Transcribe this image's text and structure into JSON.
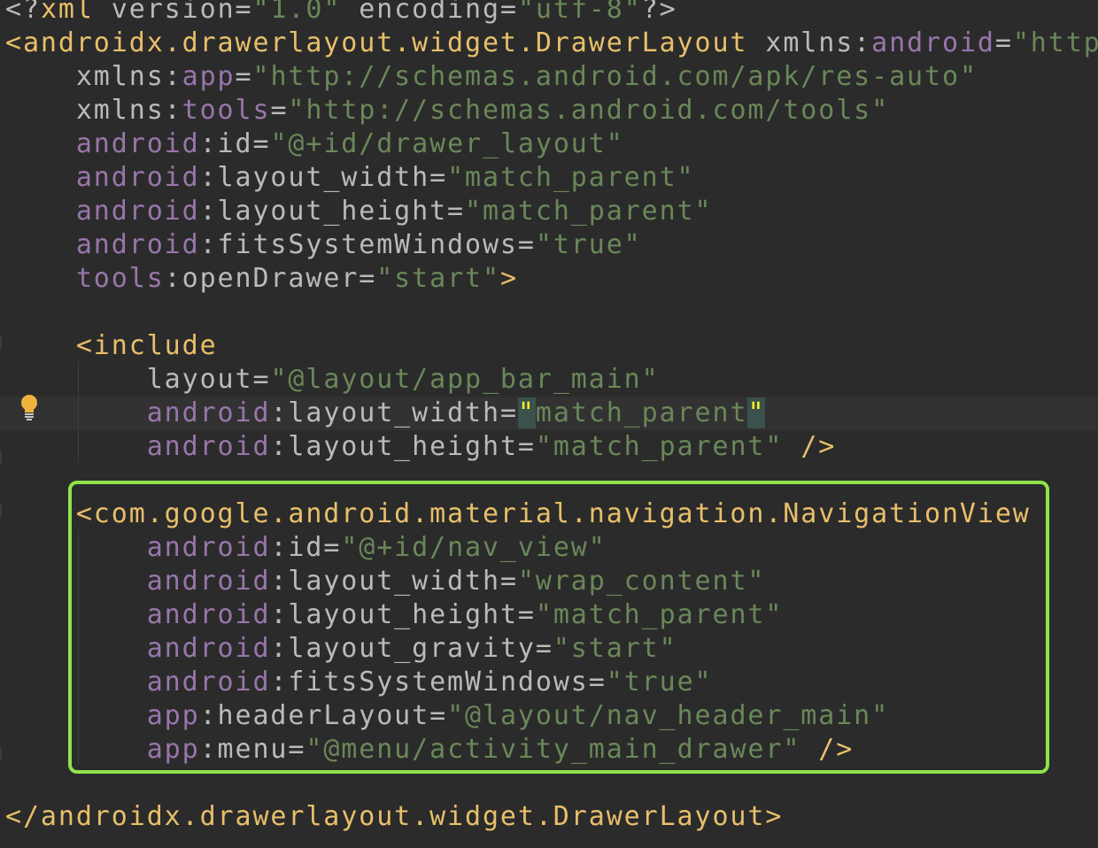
{
  "editor": {
    "language": "xml",
    "colors": {
      "background": "#2b2b2b",
      "tag": "#e8bf6a",
      "namespace": "#9876aa",
      "attribute": "#bababa",
      "string": "#6a8759",
      "highlight_border": "#8fe24a"
    },
    "lines": [
      [
        [
          "punct",
          "<?"
        ],
        [
          "tag",
          "xml "
        ],
        [
          "attr",
          "version"
        ],
        [
          "punct",
          "="
        ],
        [
          "val",
          "\"1.0\" "
        ],
        [
          "attr",
          "encoding"
        ],
        [
          "punct",
          "="
        ],
        [
          "val",
          "\"utf-8\""
        ],
        [
          "punct",
          "?>"
        ]
      ],
      [
        [
          "tag",
          "<androidx.drawerlayout.widget.DrawerLayout "
        ],
        [
          "attr",
          "xmlns:"
        ],
        [
          "ns",
          "android"
        ],
        [
          "punct",
          "="
        ],
        [
          "val",
          "\"http"
        ]
      ],
      [
        [
          "attr",
          "    xmlns:"
        ],
        [
          "ns",
          "app"
        ],
        [
          "punct",
          "="
        ],
        [
          "val",
          "\"http://schemas.android.com/apk/res-auto\""
        ]
      ],
      [
        [
          "attr",
          "    xmlns:"
        ],
        [
          "ns",
          "tools"
        ],
        [
          "punct",
          "="
        ],
        [
          "val",
          "\"http://schemas.android.com/tools\""
        ]
      ],
      [
        [
          "ns",
          "    android"
        ],
        [
          "punct",
          ":"
        ],
        [
          "attr",
          "id"
        ],
        [
          "punct",
          "="
        ],
        [
          "val",
          "\"@+id/drawer_layout\""
        ]
      ],
      [
        [
          "ns",
          "    android"
        ],
        [
          "punct",
          ":"
        ],
        [
          "attr",
          "layout_width"
        ],
        [
          "punct",
          "="
        ],
        [
          "val",
          "\"match_parent\""
        ]
      ],
      [
        [
          "ns",
          "    android"
        ],
        [
          "punct",
          ":"
        ],
        [
          "attr",
          "layout_height"
        ],
        [
          "punct",
          "="
        ],
        [
          "val",
          "\"match_parent\""
        ]
      ],
      [
        [
          "ns",
          "    android"
        ],
        [
          "punct",
          ":"
        ],
        [
          "attr",
          "fitsSystemWindows"
        ],
        [
          "punct",
          "="
        ],
        [
          "val",
          "\"true\""
        ]
      ],
      [
        [
          "ns",
          "    tools"
        ],
        [
          "punct",
          ":"
        ],
        [
          "attr",
          "openDrawer"
        ],
        [
          "punct",
          "="
        ],
        [
          "val",
          "\"start\""
        ],
        [
          "tag",
          ">"
        ]
      ],
      [],
      [
        [
          "tag",
          "    <include"
        ]
      ],
      [
        [
          "attr",
          "        layout"
        ],
        [
          "punct",
          "="
        ],
        [
          "val",
          "\"@layout/app_bar_main\""
        ]
      ],
      [
        [
          "ns",
          "        android"
        ],
        [
          "punct",
          ":"
        ],
        [
          "attr",
          "layout_width"
        ],
        [
          "punct",
          "="
        ],
        [
          "quote-hl",
          "\""
        ],
        [
          "val",
          "match_parent"
        ],
        [
          "quote-hl",
          "\""
        ]
      ],
      [
        [
          "ns",
          "        android"
        ],
        [
          "punct",
          ":"
        ],
        [
          "attr",
          "layout_height"
        ],
        [
          "punct",
          "="
        ],
        [
          "val",
          "\"match_parent\" "
        ],
        [
          "tag",
          "/>"
        ]
      ],
      [],
      [
        [
          "tag",
          "    <com.google.android.material.navigation.NavigationView"
        ]
      ],
      [
        [
          "ns",
          "        android"
        ],
        [
          "punct",
          ":"
        ],
        [
          "attr",
          "id"
        ],
        [
          "punct",
          "="
        ],
        [
          "val",
          "\"@+id/nav_view\""
        ]
      ],
      [
        [
          "ns",
          "        android"
        ],
        [
          "punct",
          ":"
        ],
        [
          "attr",
          "layout_width"
        ],
        [
          "punct",
          "="
        ],
        [
          "val",
          "\"wrap_content\""
        ]
      ],
      [
        [
          "ns",
          "        android"
        ],
        [
          "punct",
          ":"
        ],
        [
          "attr",
          "layout_height"
        ],
        [
          "punct",
          "="
        ],
        [
          "val",
          "\"match_parent\""
        ]
      ],
      [
        [
          "ns",
          "        android"
        ],
        [
          "punct",
          ":"
        ],
        [
          "attr",
          "layout_gravity"
        ],
        [
          "punct",
          "="
        ],
        [
          "val",
          "\"start\""
        ]
      ],
      [
        [
          "ns",
          "        android"
        ],
        [
          "punct",
          ":"
        ],
        [
          "attr",
          "fitsSystemWindows"
        ],
        [
          "punct",
          "="
        ],
        [
          "val",
          "\"true\""
        ]
      ],
      [
        [
          "ns",
          "        app"
        ],
        [
          "punct",
          ":"
        ],
        [
          "attr",
          "headerLayout"
        ],
        [
          "punct",
          "="
        ],
        [
          "val",
          "\"@layout/nav_header_main\""
        ]
      ],
      [
        [
          "ns",
          "        app"
        ],
        [
          "punct",
          ":"
        ],
        [
          "attr",
          "menu"
        ],
        [
          "punct",
          "="
        ],
        [
          "val",
          "\"@menu/activity_main_drawer\" "
        ],
        [
          "tag",
          "/>"
        ]
      ],
      [],
      [
        [
          "tag",
          "</androidx.drawerlayout.widget.DrawerLayout>"
        ]
      ]
    ],
    "current_line_index": 12,
    "intention_icon": "lightbulb-icon"
  }
}
